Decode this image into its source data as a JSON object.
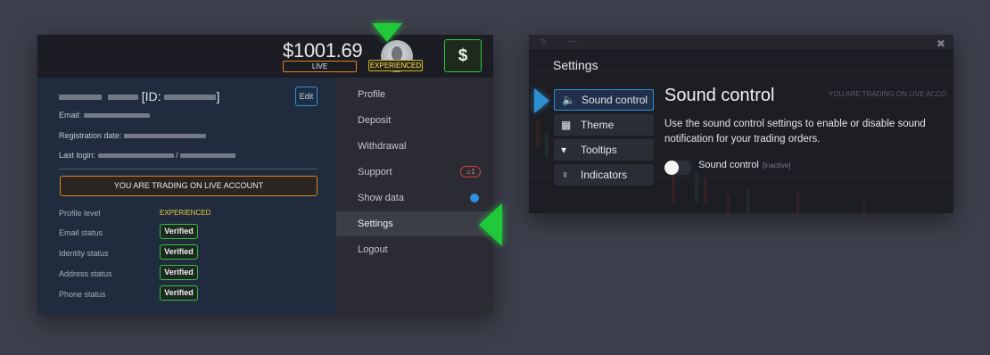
{
  "header": {
    "balance": "$1001.69",
    "account_mode": "LIVE",
    "profile_level_badge": "EXPERIENCED",
    "deposit_icon": "dollar-icon",
    "deposit_symbol": "$"
  },
  "profile": {
    "id_label": "[ID:",
    "id_close": "]",
    "edit_label": "Edit",
    "email_label": "Email:",
    "registration_label": "Registration date:",
    "last_login_label": "Last login:",
    "last_login_sep": "/",
    "live_notice": "YOU ARE TRADING ON LIVE ACCOUNT",
    "profile_level_label": "Profile level",
    "profile_level_value": "EXPERIENCED",
    "statuses": [
      {
        "label": "Email status",
        "value": "Verified"
      },
      {
        "label": "Identity status",
        "value": "Verified"
      },
      {
        "label": "Address status",
        "value": "Verified"
      },
      {
        "label": "Phone status",
        "value": "Verified"
      }
    ]
  },
  "menu": {
    "items": [
      {
        "label": "Profile"
      },
      {
        "label": "Deposit"
      },
      {
        "label": "Withdrawal"
      },
      {
        "label": "Support",
        "badge": "1"
      },
      {
        "label": "Show data"
      },
      {
        "label": "Settings"
      },
      {
        "label": "Logout"
      }
    ]
  },
  "settings": {
    "title": "Settings",
    "tabs": [
      {
        "label": "Sound control",
        "icon": "speaker-icon"
      },
      {
        "label": "Theme",
        "icon": "grid-icon"
      },
      {
        "label": "Tooltips",
        "icon": "tooltip-icon"
      },
      {
        "label": "Indicators",
        "icon": "lightbulb-icon"
      }
    ],
    "heading": "Sound control",
    "description": "Use the sound control settings to enable or disable sound notification for your trading orders.",
    "toggle_label": "Sound control",
    "toggle_state": "[inactive]",
    "background_text": "YOU ARE TRADING ON LIVE ACCO"
  },
  "colors": {
    "live": "#e0801e",
    "experienced": "#c9b030",
    "verified": "#37bb45",
    "accent_blue": "#2d8fd1",
    "highlight_green": "#21c93a"
  }
}
